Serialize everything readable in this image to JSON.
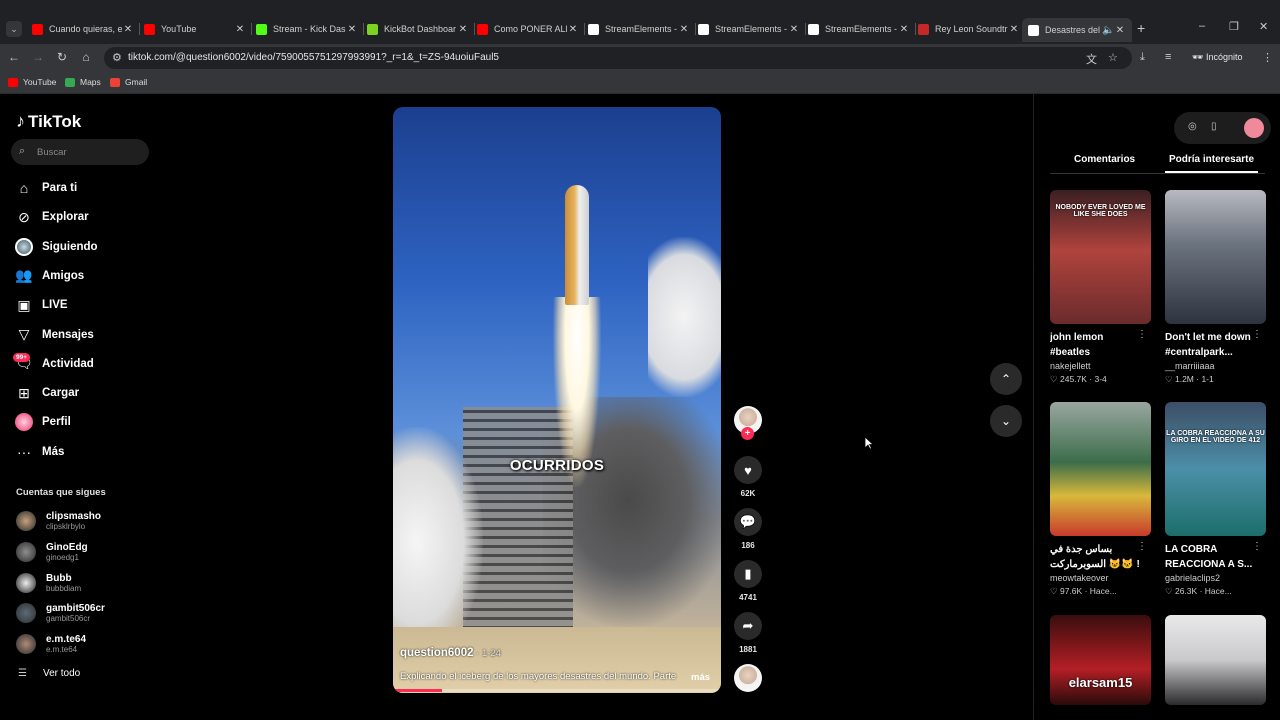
{
  "browser": {
    "tabs": [
      {
        "title": "Cuando quieras, e",
        "color": "#ff0000"
      },
      {
        "title": "YouTube",
        "color": "#ff0000"
      },
      {
        "title": "Stream - Kick Das",
        "color": "#53fc18"
      },
      {
        "title": "KickBot Dashboar",
        "color": "#7cd321"
      },
      {
        "title": "Como PONER ALE",
        "color": "#ff0000"
      },
      {
        "title": "StreamElements -",
        "color": "#ffffff"
      },
      {
        "title": "StreamElements -",
        "color": "#ffffff"
      },
      {
        "title": "StreamElements -",
        "color": "#ffffff"
      },
      {
        "title": "Rey Leon Soundtr",
        "color": "#c62828"
      },
      {
        "title": "Desastres del",
        "color": "#ffffff"
      }
    ],
    "url": "tiktok.com/@question6002/video/7590055751297993991?_r=1&_t=ZS-94uoiuFaul5",
    "incognito_label": "Incógnito",
    "bookmarks": [
      {
        "label": "YouTube",
        "color": "#ff0000"
      },
      {
        "label": "Maps",
        "color": "#34a853"
      },
      {
        "label": "Gmail",
        "color": "#ea4335"
      }
    ]
  },
  "tiktok": {
    "logo": "TikTok",
    "search_placeholder": "Buscar",
    "menu": [
      {
        "label": "Para ti",
        "icon": "home-icon"
      },
      {
        "label": "Explorar",
        "icon": "compass-icon"
      },
      {
        "label": "Siguiendo",
        "icon": "following-avatar"
      },
      {
        "label": "Amigos",
        "icon": "friends-icon"
      },
      {
        "label": "LIVE",
        "icon": "live-icon"
      },
      {
        "label": "Mensajes",
        "icon": "messages-icon"
      },
      {
        "label": "Actividad",
        "icon": "activity-icon",
        "badge": "99+"
      },
      {
        "label": "Cargar",
        "icon": "upload-icon"
      },
      {
        "label": "Perfil",
        "icon": "profile-avatar"
      },
      {
        "label": "Más",
        "icon": "more-icon"
      }
    ],
    "following_header": "Cuentas que sigues",
    "following": [
      {
        "name": "clipsmasho",
        "handle": "clipsklrbylo"
      },
      {
        "name": "GinoEdg",
        "handle": "ginoedg1"
      },
      {
        "name": "Bubb",
        "handle": "bubbdiam"
      },
      {
        "name": "gambit506cr",
        "handle": "gambit506cr"
      },
      {
        "name": "e.m.te64",
        "handle": "e.m.te64"
      }
    ],
    "see_all": "Ver todo",
    "video": {
      "caption_overlay": "OCURRIDOS",
      "author": "question6002",
      "date": " · 1-24",
      "description": "Explicando el iceberg de los mayores desastres del mundo. Parte",
      "more": "más",
      "progress": 0.15,
      "likes": "62K",
      "comments": "186",
      "saves": "4741",
      "shares": "1881"
    },
    "right_tabs": [
      "Comentarios",
      "Podría interesarte"
    ],
    "recommendations": [
      {
        "title": "john lemon #beatles",
        "line2": "#beatles",
        "line1": "john lemon",
        "user": "nakejellett",
        "likes": "245.7K",
        "date": "3-4",
        "overlay": "NOBODY EVER LOVED ME LIKE SHE DOES"
      },
      {
        "title": "Don't let me down",
        "line1": "Don't let me down",
        "line2": "#centralpark...",
        "user": "__marriiiaaa",
        "likes": "1.2M",
        "date": "1-1",
        "overlay": ""
      },
      {
        "line1": "بساس جدة في",
        "line2": "السوبرماركت 😺🐱 !",
        "user": "meowtakeover",
        "likes": "97.6K",
        "date": "Hace...",
        "overlay": ""
      },
      {
        "line1": "LA COBRA",
        "line2": "REACCIONA A S...",
        "user": "gabrielaclips2",
        "likes": "26.3K",
        "date": "Hace...",
        "overlay": "LA COBRA REACCIONA A SU GIRO EN EL VIDEO DE 412"
      },
      {
        "line1": "",
        "line2": "",
        "user": "",
        "likes": "",
        "date": "",
        "overlay": "elarsam15"
      },
      {
        "line1": "",
        "line2": "",
        "user": "",
        "likes": "",
        "date": "",
        "overlay": ""
      }
    ]
  }
}
